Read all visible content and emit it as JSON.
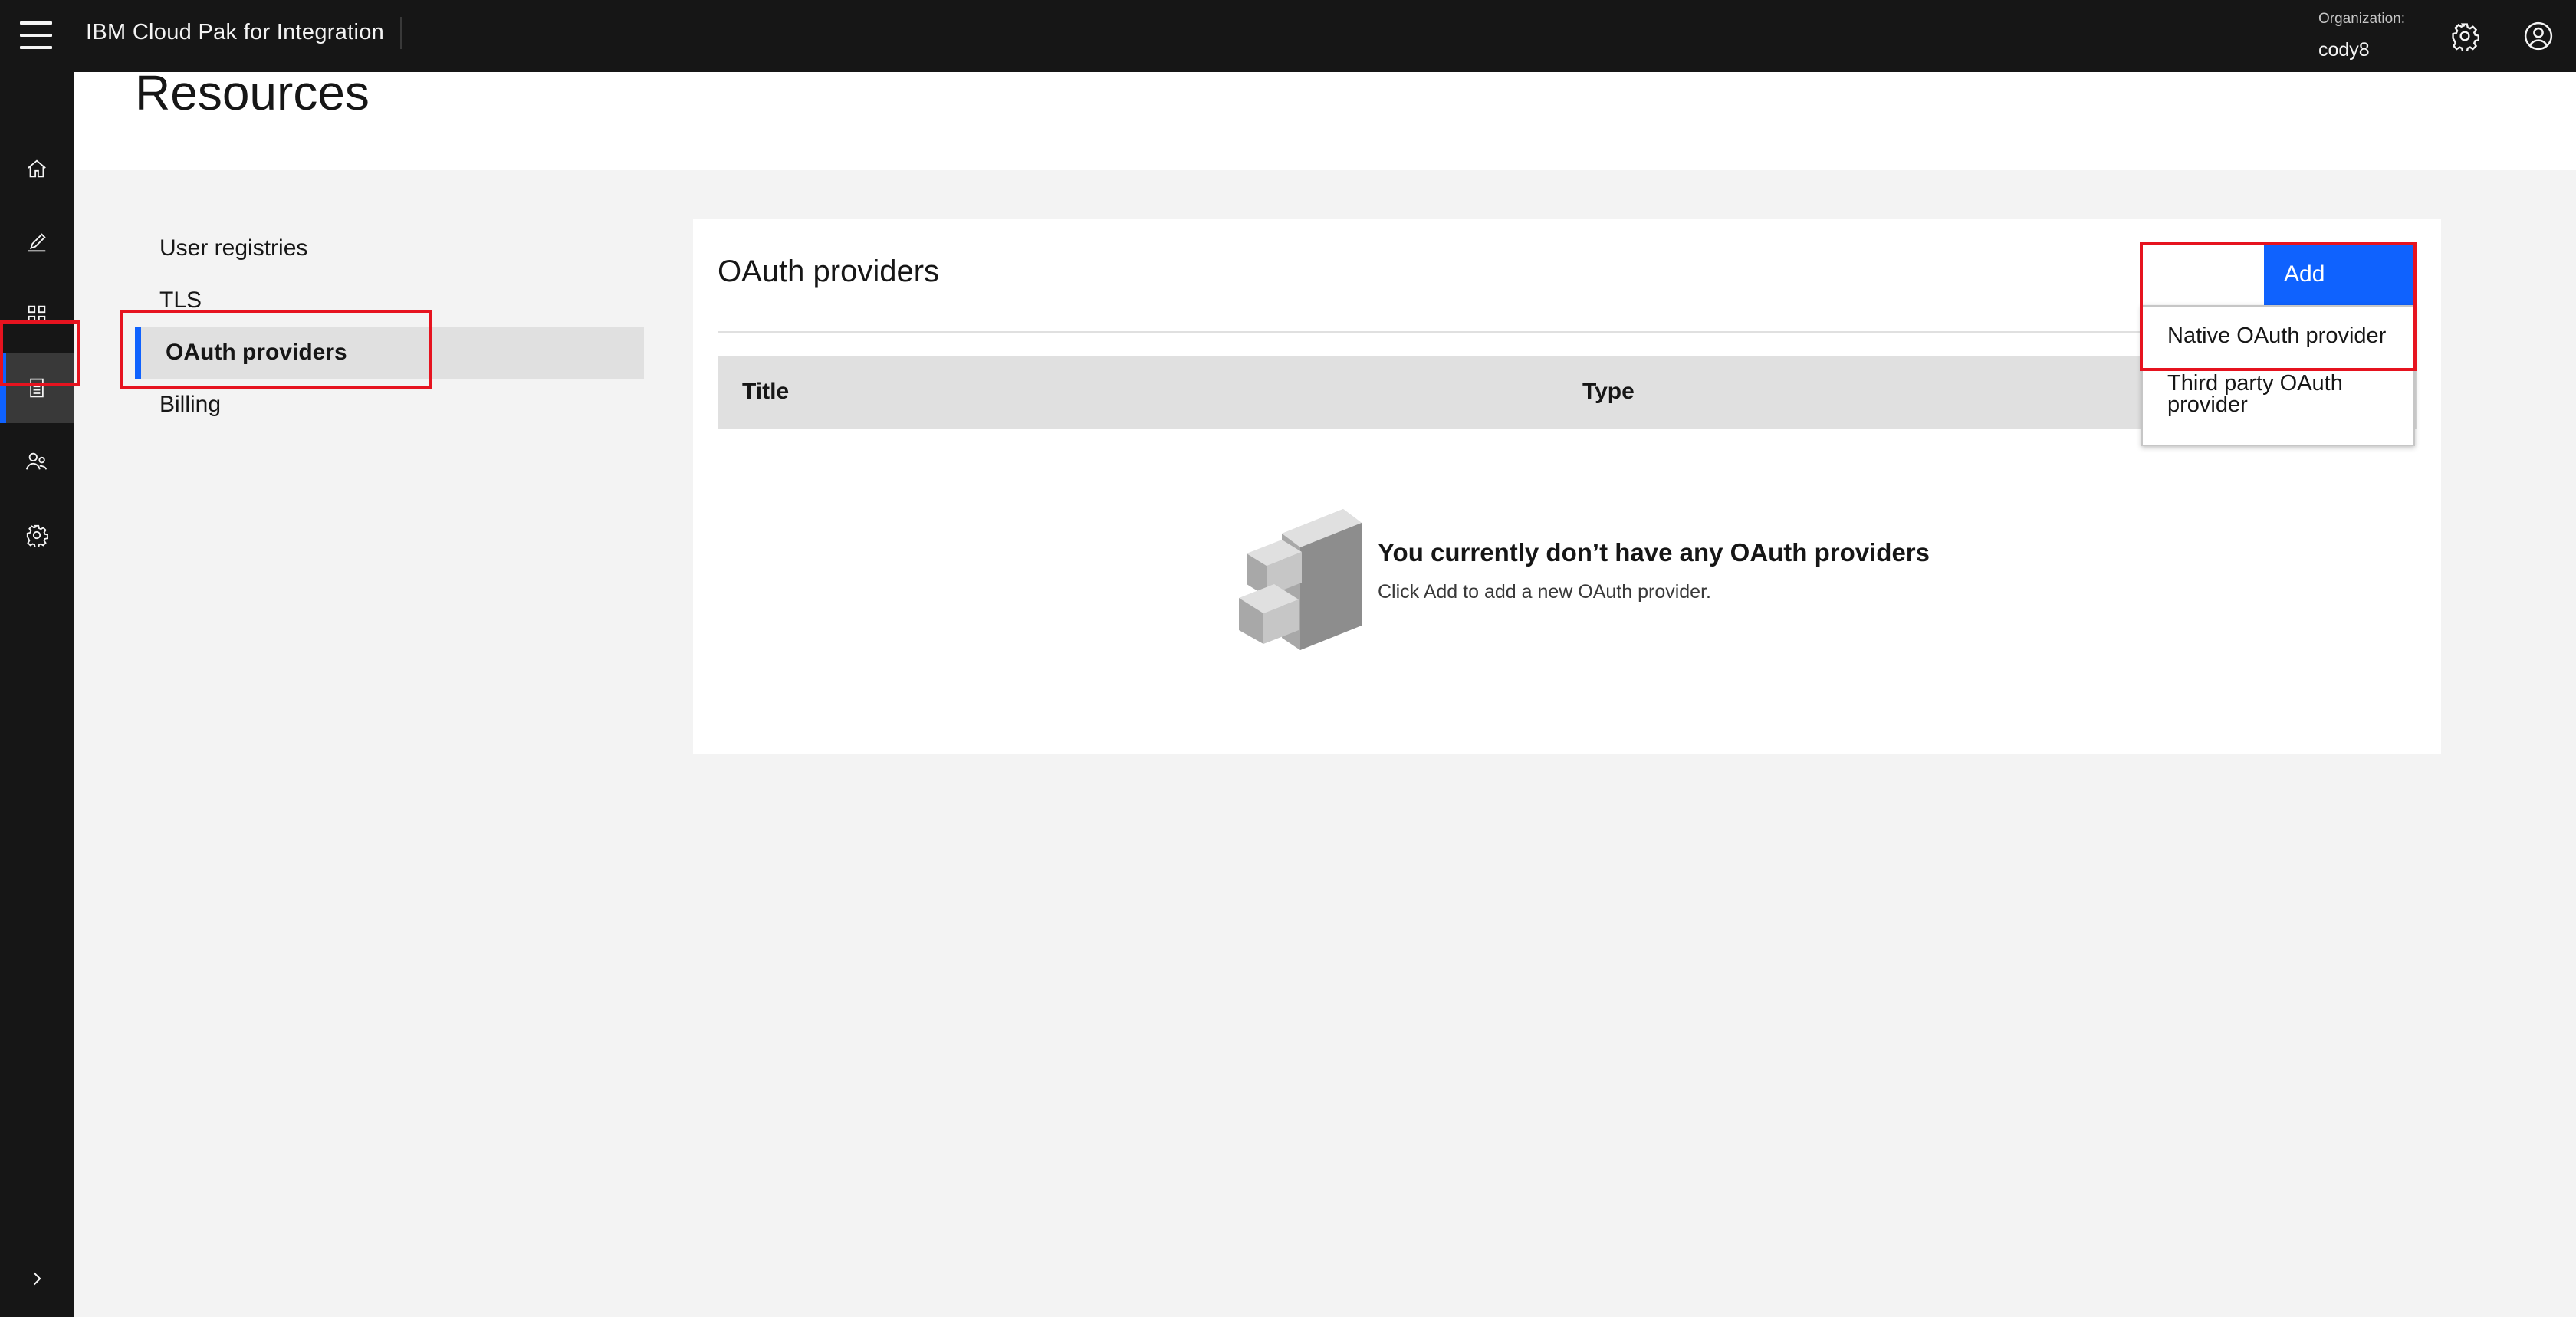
{
  "header": {
    "app_title": "IBM Cloud Pak for Integration",
    "org_label": "Organization:",
    "org_value": "cody8",
    "settings_icon": "gear-icon",
    "user_icon": "user-avatar-icon"
  },
  "siderail": {
    "items": [
      {
        "icon": "home-icon"
      },
      {
        "icon": "edit-icon"
      },
      {
        "icon": "apps-grid-icon"
      },
      {
        "icon": "resources-icon",
        "active": true
      },
      {
        "icon": "members-icon"
      },
      {
        "icon": "settings-icon"
      }
    ],
    "expand_icon": "chevron-right-icon"
  },
  "page": {
    "title": "Resources"
  },
  "subnav": {
    "items": [
      {
        "label": "User registries"
      },
      {
        "label": "TLS"
      },
      {
        "label": "OAuth providers",
        "active": true
      },
      {
        "label": "Billing"
      }
    ]
  },
  "card": {
    "title": "OAuth providers",
    "add_label": "Add",
    "columns": [
      "Title",
      "Type"
    ],
    "empty_title": "You currently don’t have any OAuth providers",
    "empty_desc": "Click Add to add a new OAuth provider."
  },
  "dropdown": {
    "items": [
      "Native OAuth provider",
      "Third party OAuth provider"
    ]
  },
  "colors": {
    "accent": "#0f62fe",
    "highlight": "#e6131f",
    "header_bg": "#161616"
  }
}
